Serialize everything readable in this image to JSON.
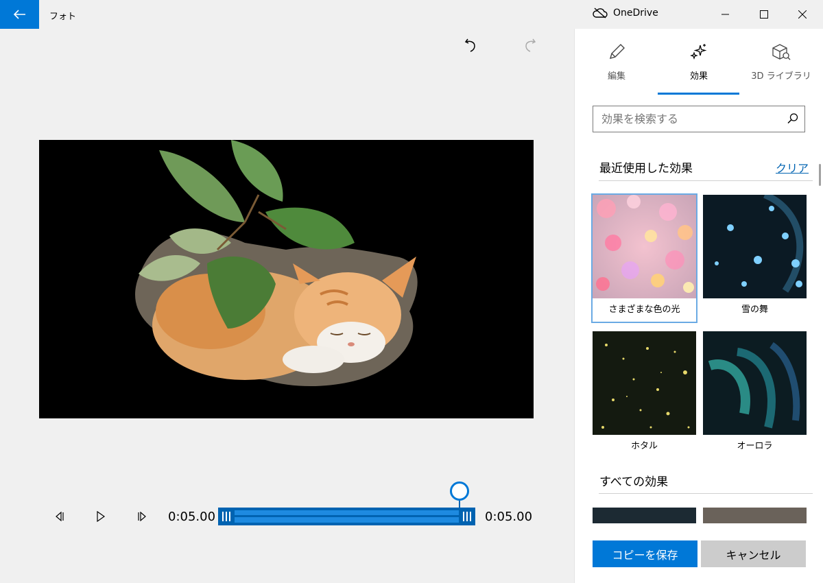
{
  "app": {
    "title": "フォト"
  },
  "titlebar": {
    "onedrive_label": "OneDrive",
    "icons": [
      "back-arrow-icon",
      "cloud-offline-icon",
      "minimize-icon",
      "maximize-icon",
      "close-icon"
    ]
  },
  "toolbar": {
    "undo_icon": "undo-icon",
    "redo_icon": "redo-icon"
  },
  "player": {
    "start_time": "0:05.00",
    "end_time": "0:05.00",
    "playhead_fraction": 0.94,
    "icons": [
      "previous-frame-icon",
      "play-icon",
      "next-frame-icon"
    ]
  },
  "panel": {
    "tabs": [
      {
        "label": "編集",
        "icon": "pencil-icon",
        "active": false
      },
      {
        "label": "効果",
        "icon": "sparkle-icon",
        "active": true
      },
      {
        "label": "3D ライブラリ",
        "icon": "cube-icon",
        "active": false
      }
    ],
    "search": {
      "placeholder": "効果を検索する",
      "value": ""
    },
    "recent": {
      "title": "最近使用した効果",
      "clear_label": "クリア",
      "effects": [
        {
          "label": "さまざまな色の光",
          "selected": true
        },
        {
          "label": "雪の舞",
          "selected": false
        },
        {
          "label": "ホタル",
          "selected": false
        },
        {
          "label": "オーロラ",
          "selected": false
        }
      ]
    },
    "all": {
      "title": "すべての効果"
    },
    "save_label": "コピーを保存",
    "cancel_label": "キャンセル"
  },
  "colors": {
    "accent": "#0078d7",
    "accent_dark": "#0063b1",
    "panel_bg": "#ffffff",
    "app_bg": "#f0f0f0"
  }
}
